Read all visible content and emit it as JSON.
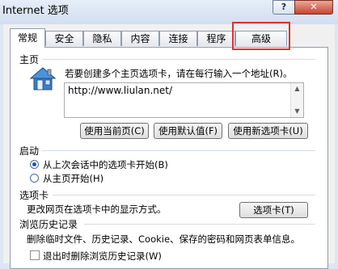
{
  "window": {
    "title": "Internet 选项",
    "help_label": "?",
    "close_label": "✕"
  },
  "tabs": [
    {
      "label": "常规"
    },
    {
      "label": "安全"
    },
    {
      "label": "隐私"
    },
    {
      "label": "内容"
    },
    {
      "label": "连接"
    },
    {
      "label": "程序"
    },
    {
      "label": "高级"
    }
  ],
  "home": {
    "heading": "主页",
    "description": "若要创建多个主页选项卡，请在每行输入一个地址(R)。",
    "url": "http://www.liulan.net/",
    "buttons": {
      "current": "使用当前页(C)",
      "default": "使用默认值(F)",
      "new_tab": "使用新选项卡(U)"
    }
  },
  "startup": {
    "heading": "启动",
    "option_last_session": "从上次会话中的选项卡开始(B)",
    "option_home": "从主页开始(H)",
    "selected": "last_session"
  },
  "tabs_group": {
    "heading": "选项卡",
    "description": "更改网页在选项卡中的显示方式。",
    "button": "选项卡(T)"
  },
  "history": {
    "heading": "浏览历史记录",
    "description": "删除临时文件、历史记录、Cookie、保存的密码和网页表单信息。",
    "checkbox_label": "退出时删除浏览历史记录(W)"
  },
  "icons": {
    "home": "house-icon",
    "help": "help-icon",
    "close": "close-icon"
  },
  "colors": {
    "highlight": "#e0312e",
    "accent": "#1d55b5"
  }
}
